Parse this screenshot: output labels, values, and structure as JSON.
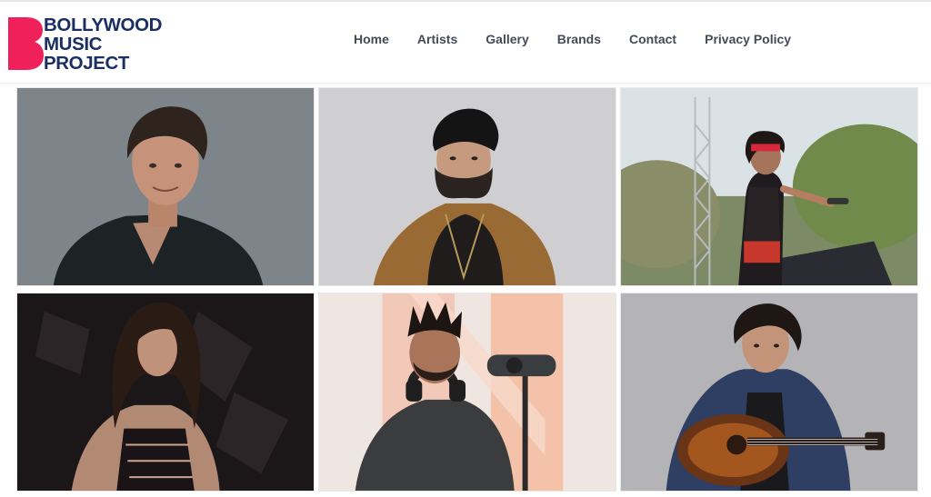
{
  "brand": {
    "logo_lines": [
      "BOLLYWOOD",
      "MUSIC",
      "PROJECT"
    ],
    "logo_letter": "B",
    "colors": {
      "mark": "#f0215a",
      "text": "#1b2f63"
    }
  },
  "nav": {
    "items": [
      {
        "label": "Home"
      },
      {
        "label": "Artists"
      },
      {
        "label": "Gallery"
      },
      {
        "label": "Brands"
      },
      {
        "label": "Contact"
      },
      {
        "label": "Privacy Policy"
      }
    ]
  },
  "gallery": {
    "photos": [
      {
        "subject": "male-artist-dark-jacket-portrait"
      },
      {
        "subject": "male-artist-black-turban-portrait"
      },
      {
        "subject": "female-artist-performing-outdoor-stage"
      },
      {
        "subject": "female-artist-dark-studio-portrait"
      },
      {
        "subject": "male-artist-headphones-studio-microphone"
      },
      {
        "subject": "male-artist-acoustic-guitar-portrait"
      }
    ]
  }
}
